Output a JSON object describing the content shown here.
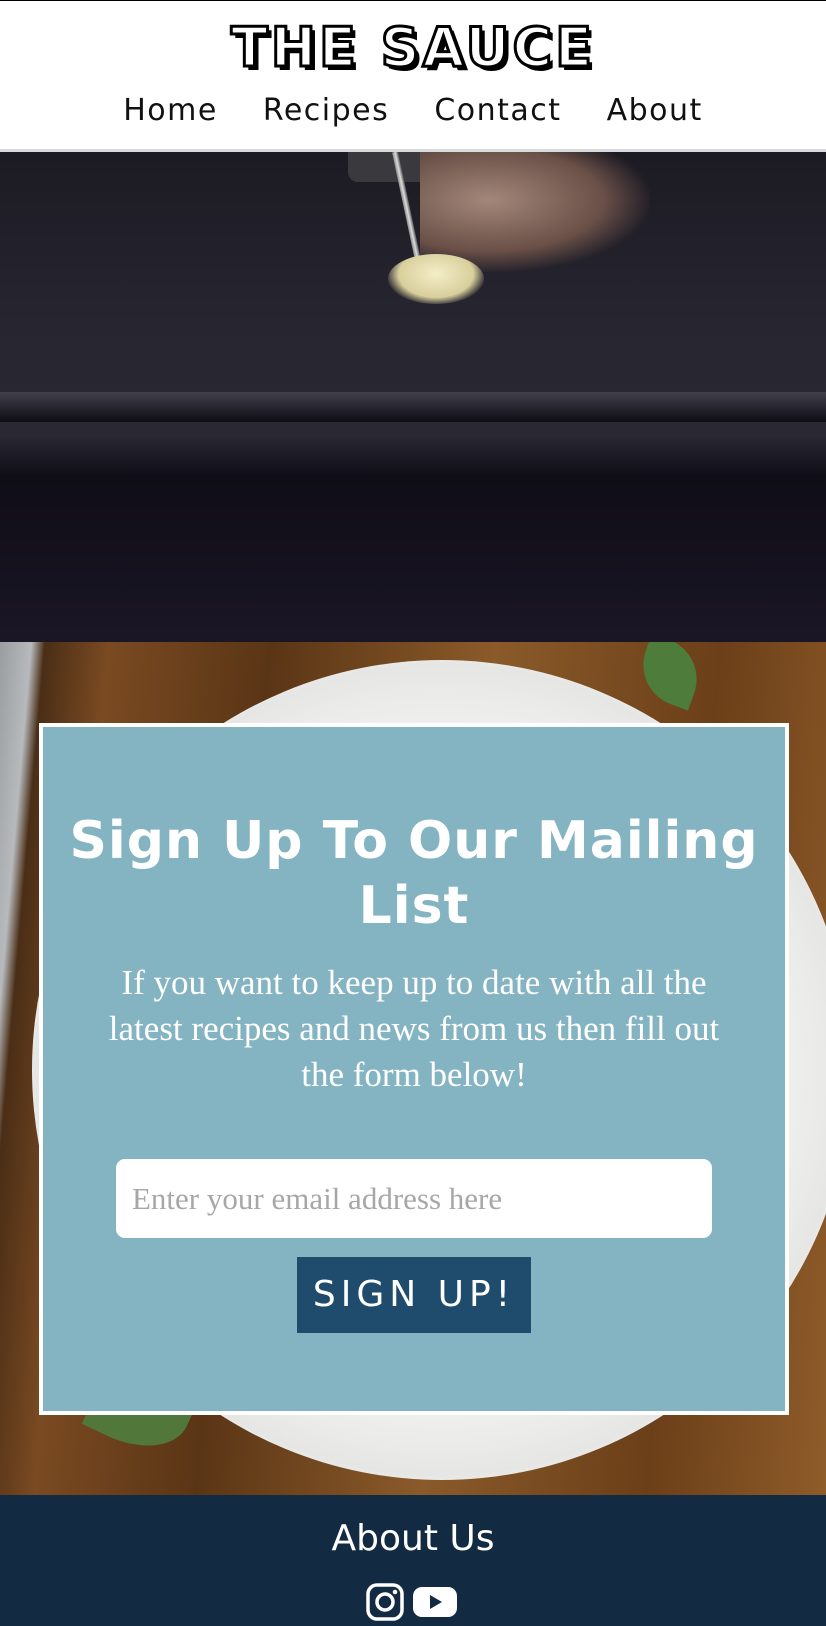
{
  "header": {
    "logo": "THE SAUCE",
    "nav": [
      "Home",
      "Recipes",
      "Contact",
      "About"
    ]
  },
  "signup": {
    "title": "Sign Up To Our Mailing List",
    "text": "If you want to keep up to date with all the latest recipes and news from us then fill out the form below!",
    "email_placeholder": "Enter your email address here",
    "button_label": "SIGN UP!"
  },
  "footer": {
    "title": "About Us",
    "icons": [
      "instagram-icon",
      "youtube-icon"
    ]
  },
  "colors": {
    "card": "#84b4c2",
    "button": "#1f4b6d",
    "footer": "#132b42"
  }
}
